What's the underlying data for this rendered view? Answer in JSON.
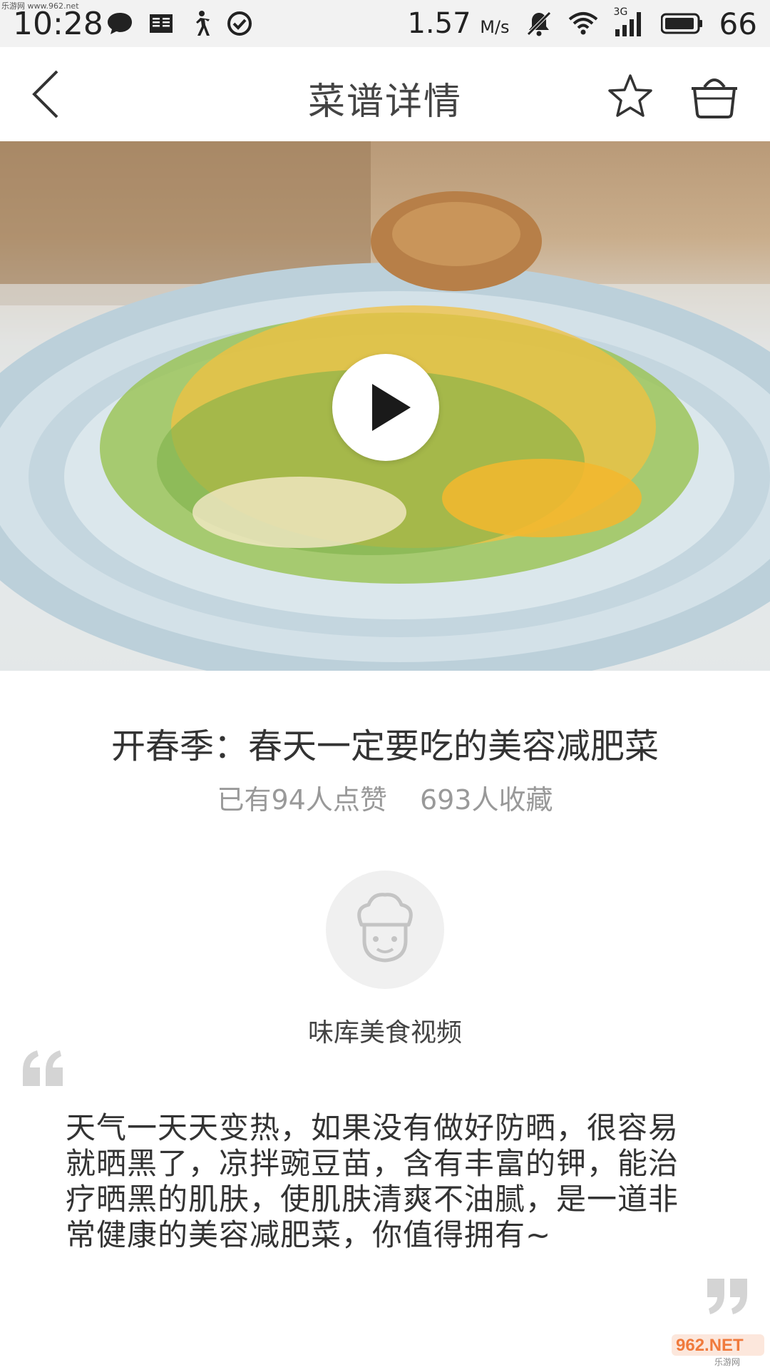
{
  "status_bar": {
    "time": "10:28",
    "speed_value": "1.57",
    "speed_unit": "M/s",
    "network_type": "3G",
    "battery_level": "66",
    "icons": [
      "message-icon",
      "reader-icon",
      "walking-icon",
      "check-circle-icon",
      "mute-icon",
      "wifi-icon",
      "signal-icon",
      "battery-icon"
    ]
  },
  "top_watermark": "乐游网 www.962.net",
  "header": {
    "title": "菜谱详情",
    "icons": [
      "back-arrow-icon",
      "star-icon",
      "basket-icon"
    ]
  },
  "video": {
    "icon": "play-icon"
  },
  "recipe": {
    "title": "开春季：春天一定要吃的美容减肥菜",
    "likes_text": "已有94人点赞",
    "favorites_text": "693人收藏"
  },
  "author": {
    "name": "味库美食视频",
    "avatar_icon": "chef-avatar-icon"
  },
  "description": "天气一天天变热，如果没有做好防晒，很容易就晒黑了，凉拌豌豆苗，含有丰富的钾，能治疗晒黑的肌肤，使肌肤清爽不油腻，是一道非常健康的美容减肥菜，你值得拥有~",
  "bottom_watermark": {
    "brand": "962.NET",
    "sub": "乐游网"
  },
  "colors": {
    "accent_play": "#1a1a1a",
    "status_bar_bg": "#f2f2f2",
    "muted_text": "#999999"
  }
}
